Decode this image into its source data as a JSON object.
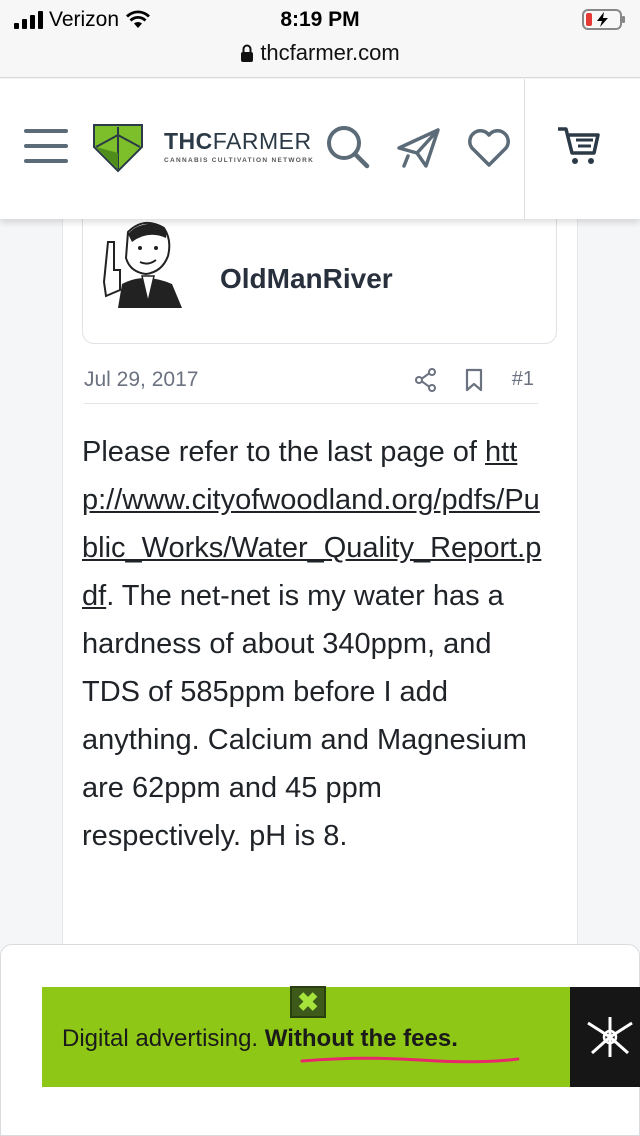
{
  "status_bar": {
    "carrier": "Verizon",
    "time": "8:19 PM"
  },
  "browser": {
    "url": "thcfarmer.com"
  },
  "header": {
    "logo_brand_bold": "THC",
    "logo_brand_light": "FARMER",
    "logo_tagline": "CANNABIS CULTIVATION NETWORK",
    "icons": [
      "menu-icon",
      "search-icon",
      "send-icon",
      "heart-icon",
      "cart-icon"
    ]
  },
  "post": {
    "username": "OldManRiver",
    "date": "Jul 29, 2017",
    "number": "#1",
    "link_text": "http://www.cityofwoodland.org/pdfs/Public_Works/Water_Quality_Report.pdf",
    "body_after_link": ". The net-net is my water has a hardness of about 340ppm, and TDS of 585ppm before I add anything. Calcium and Magnesium are 62ppm and 45 ppm respectively. pH is 8.",
    "body_before_link": "Please refer to the last page of "
  },
  "ad": {
    "text_regular": "Digital advertising. ",
    "text_bold": "Without the fees.",
    "close_label": "✖"
  },
  "colors": {
    "logo_green": "#7cbf2a",
    "logo_dark": "#2b3a46",
    "ad_green": "#8ec716",
    "icon_gray": "#5c6b78"
  }
}
